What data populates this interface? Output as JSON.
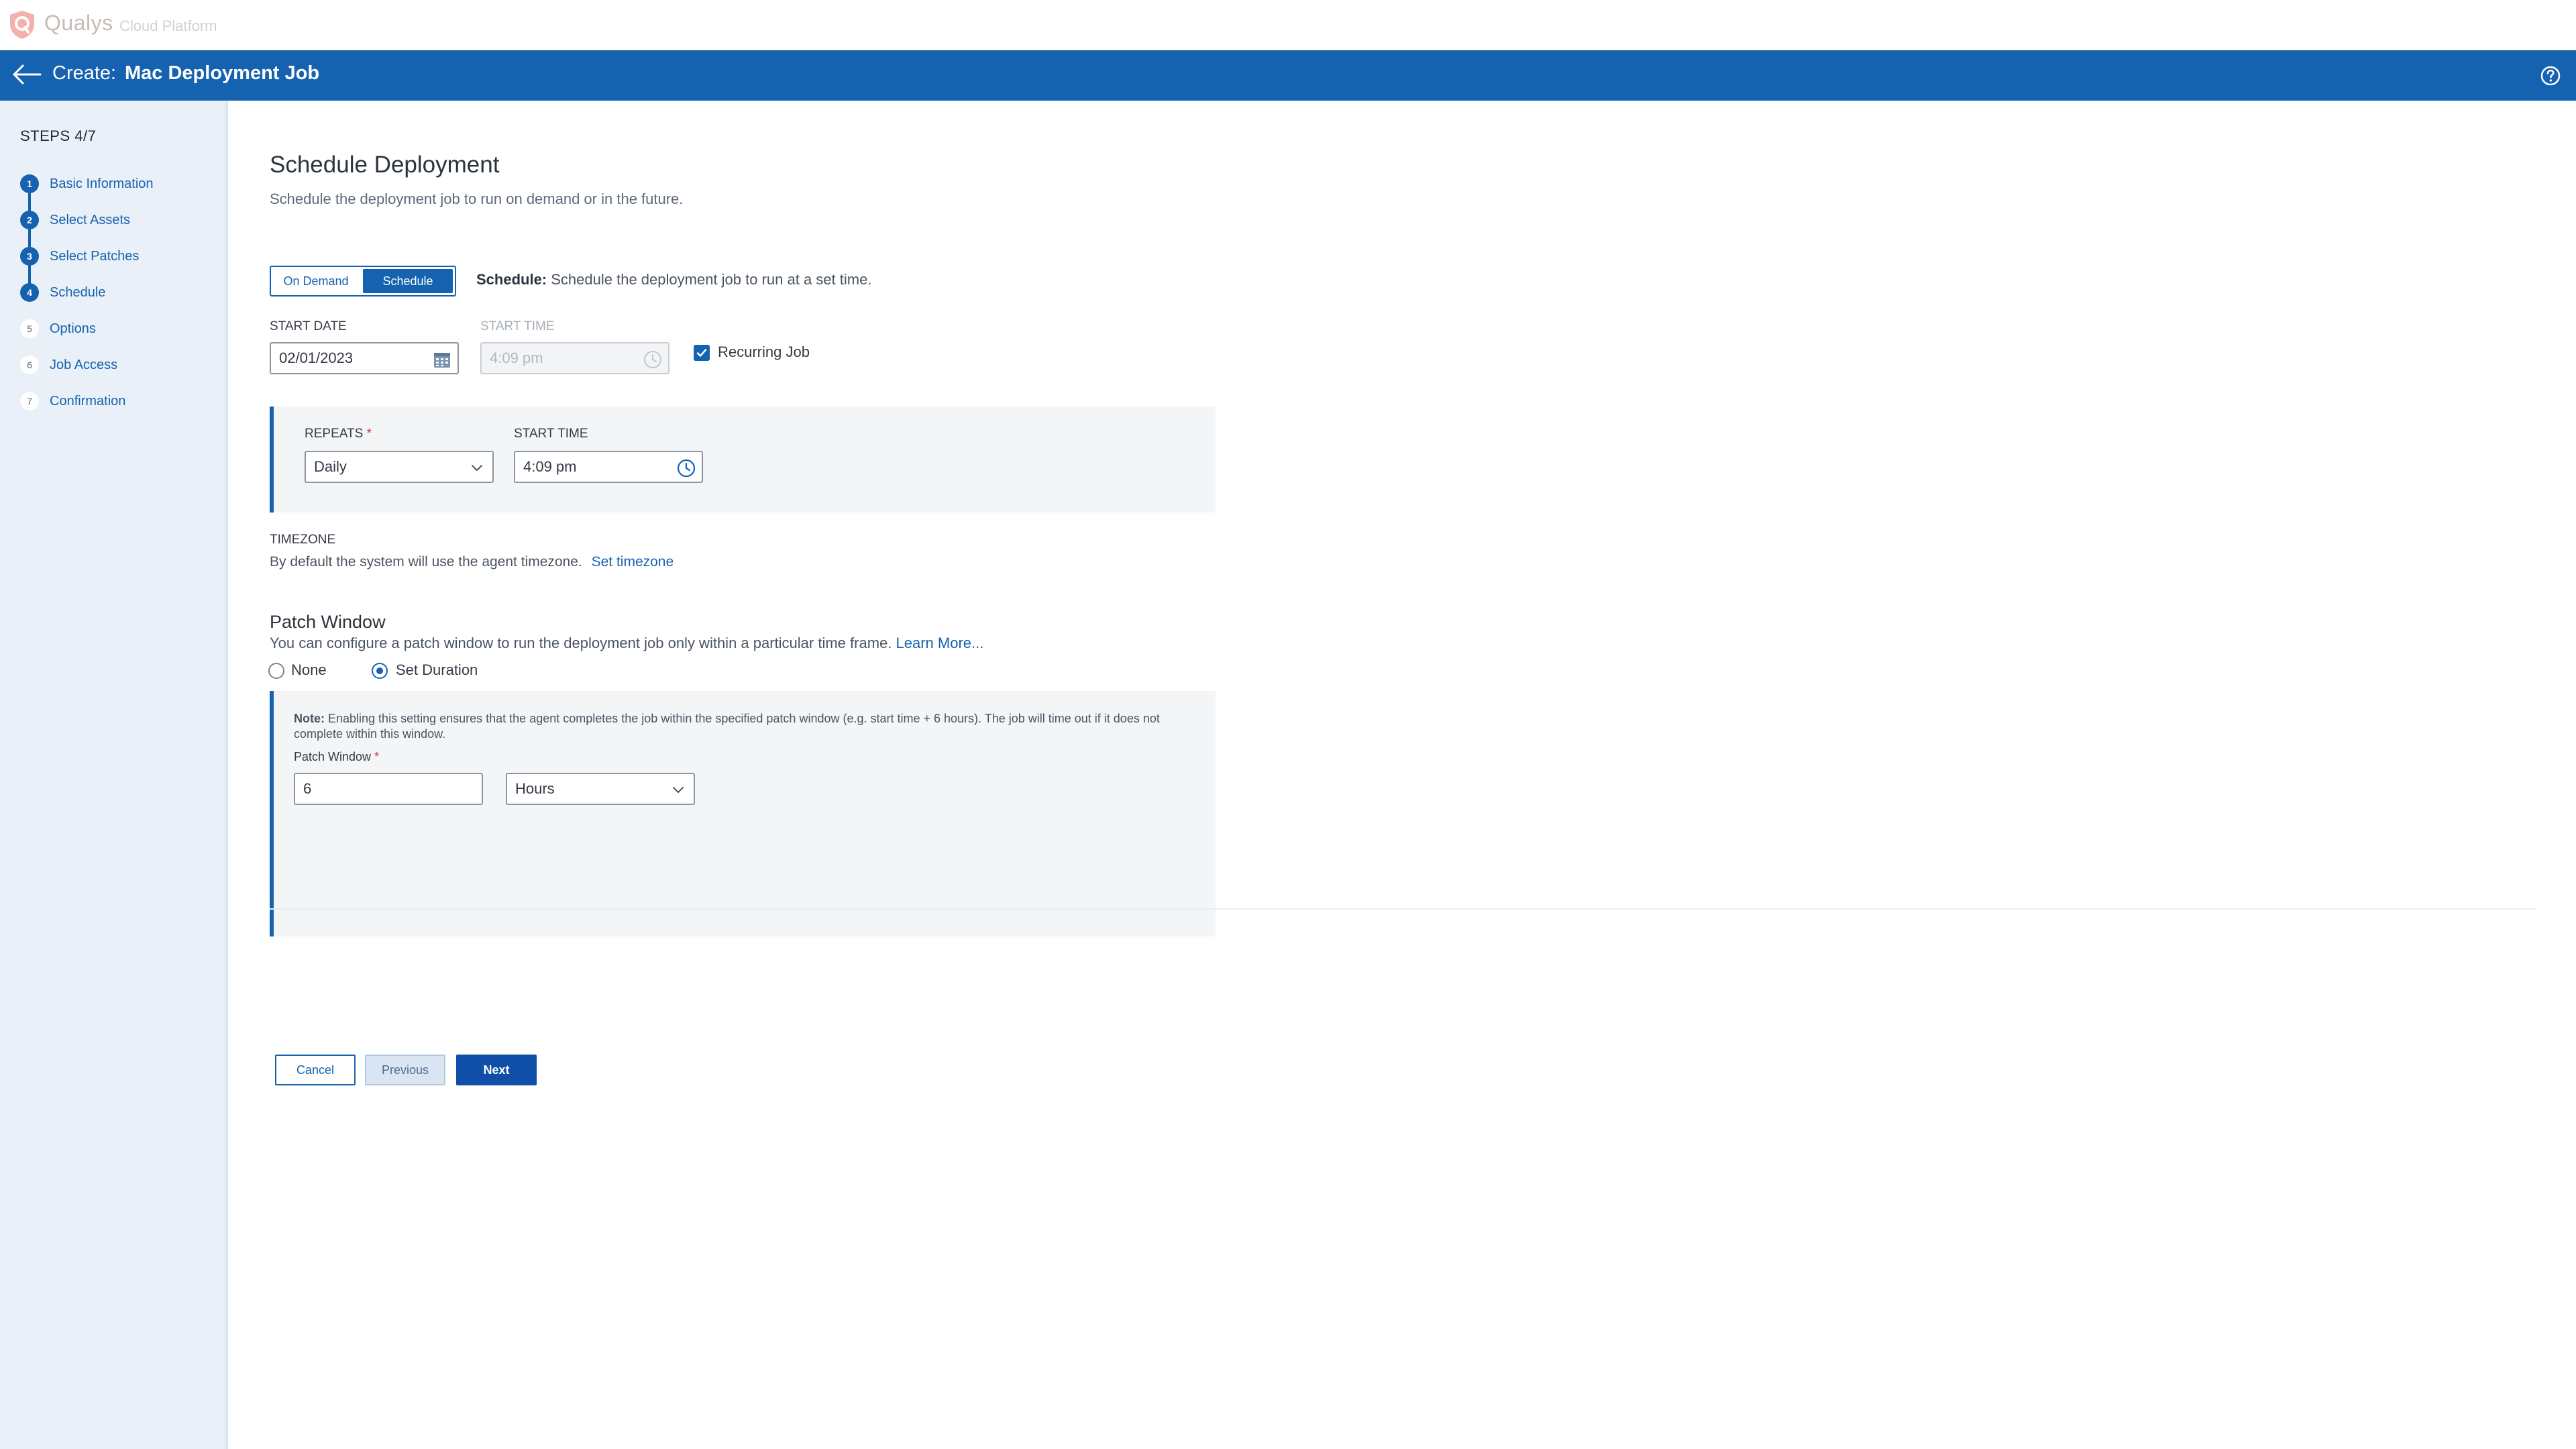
{
  "brand": {
    "name": "Qualys",
    "sub": "Cloud Platform"
  },
  "header": {
    "prefix": "Create:",
    "title": "Mac Deployment Job"
  },
  "sidebar": {
    "steps_label": "STEPS 4/7",
    "steps": [
      {
        "num": "1",
        "label": "Basic Information",
        "done": true
      },
      {
        "num": "2",
        "label": "Select Assets",
        "done": true
      },
      {
        "num": "3",
        "label": "Select Patches",
        "done": true
      },
      {
        "num": "4",
        "label": "Schedule",
        "done": true
      },
      {
        "num": "5",
        "label": "Options",
        "done": false
      },
      {
        "num": "6",
        "label": "Job Access",
        "done": false
      },
      {
        "num": "7",
        "label": "Confirmation",
        "done": false
      }
    ]
  },
  "main": {
    "title": "Schedule Deployment",
    "subtitle": "Schedule the deployment job to run on demand or in the future.",
    "mode": {
      "on_demand": "On Demand",
      "schedule": "Schedule",
      "desc_bold": "Schedule:",
      "desc": " Schedule the deployment job to run at a set time."
    },
    "start_date": {
      "label": "START DATE",
      "value": "02/01/2023"
    },
    "start_time_disabled": {
      "label": "START TIME",
      "value": "4:09 pm"
    },
    "recurring": {
      "label": "Recurring Job",
      "checked": true
    },
    "repeats": {
      "label": "REPEATS",
      "required": "*",
      "value": "Daily"
    },
    "start_time": {
      "label": "START TIME",
      "value": "4:09 pm"
    },
    "timezone": {
      "label": "TIMEZONE",
      "desc": "By default the system will use the agent timezone.",
      "link": "Set timezone"
    },
    "patch_window": {
      "title": "Patch Window",
      "desc": "You can configure a patch window to run the deployment job only within a particular time frame.",
      "learn_more": "Learn More...",
      "option_none": "None",
      "option_set": "Set Duration",
      "note_bold": "Note:",
      "note": " Enabling this setting ensures that the agent completes the job within the specified patch window (e.g. start time + 6 hours). The job will time out if it does not complete within this window.",
      "field_label": "Patch Window",
      "required": "*",
      "value": "6",
      "unit": "Hours"
    },
    "buttons": {
      "cancel": "Cancel",
      "previous": "Previous",
      "next": "Next"
    }
  },
  "colors": {
    "accent": "#1562b0",
    "brand_logo": "#f2b1ad"
  }
}
